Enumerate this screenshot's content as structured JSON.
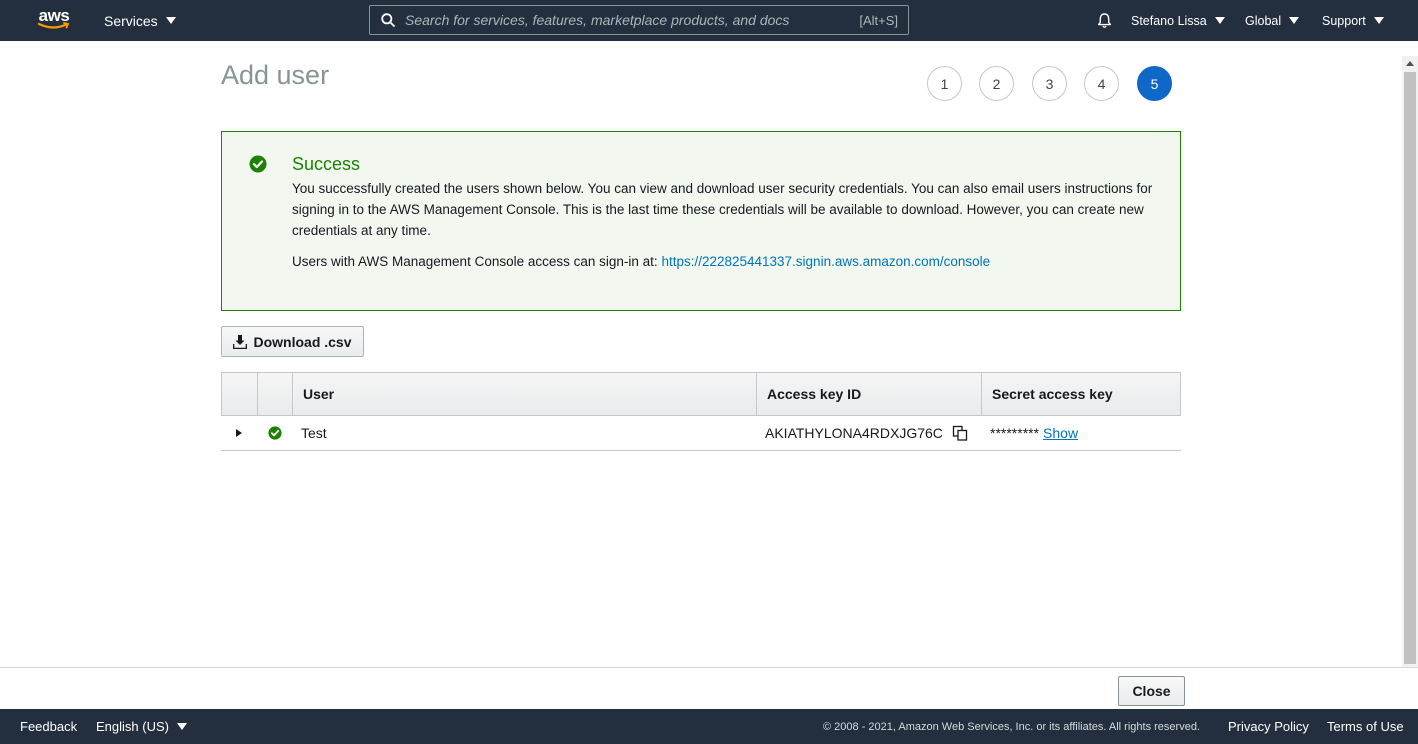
{
  "topnav": {
    "logo_text": "aws",
    "services_label": "Services",
    "search_placeholder": "Search for services, features, marketplace products, and docs",
    "search_shortcut": "[Alt+S]",
    "user_name": "Stefano Lissa",
    "region_label": "Global",
    "support_label": "Support",
    "icons": {
      "search": "search-icon",
      "bell": "bell-icon"
    }
  },
  "page": {
    "title": "Add user",
    "steps": [
      "1",
      "2",
      "3",
      "4",
      "5"
    ],
    "active_step": "5"
  },
  "success": {
    "title": "Success",
    "message": "You successfully created the users shown below. You can view and download user security credentials. You can also email users instructions for signing in to the AWS Management Console. This is the last time these credentials will be available to download. However, you can create new credentials at any time.",
    "signin_prefix": "Users with AWS Management Console access can sign-in at:",
    "signin_url": "https://222825441337.signin.aws.amazon.com/console",
    "color": "#1d8102"
  },
  "download_button": {
    "label": "Download .csv"
  },
  "table": {
    "columns": [
      "User",
      "Access key ID",
      "Secret access key"
    ],
    "rows": [
      {
        "user": "Test",
        "access_key_id": "AKIATHYLONA4RDXJG76C",
        "secret_masked": "*********",
        "show_label": "Show"
      }
    ]
  },
  "actions": {
    "close_label": "Close"
  },
  "footer": {
    "feedback": "Feedback",
    "language": "English (US)",
    "copyright": "© 2008 - 2021, Amazon Web Services, Inc. or its affiliates. All rights reserved.",
    "privacy": "Privacy Policy",
    "terms": "Terms of Use"
  },
  "colors": {
    "nav_bg": "#232f3e",
    "link": "#0073bb",
    "active_step": "#0f68c7",
    "success": "#1d8102"
  }
}
